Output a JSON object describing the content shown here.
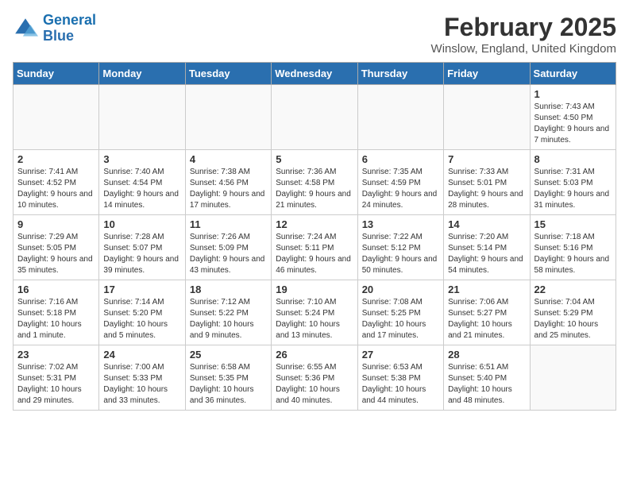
{
  "header": {
    "logo_line1": "General",
    "logo_line2": "Blue",
    "month_title": "February 2025",
    "location": "Winslow, England, United Kingdom"
  },
  "days_of_week": [
    "Sunday",
    "Monday",
    "Tuesday",
    "Wednesday",
    "Thursday",
    "Friday",
    "Saturday"
  ],
  "weeks": [
    [
      {
        "day": "",
        "text": ""
      },
      {
        "day": "",
        "text": ""
      },
      {
        "day": "",
        "text": ""
      },
      {
        "day": "",
        "text": ""
      },
      {
        "day": "",
        "text": ""
      },
      {
        "day": "",
        "text": ""
      },
      {
        "day": "1",
        "text": "Sunrise: 7:43 AM\nSunset: 4:50 PM\nDaylight: 9 hours and 7 minutes."
      }
    ],
    [
      {
        "day": "2",
        "text": "Sunrise: 7:41 AM\nSunset: 4:52 PM\nDaylight: 9 hours and 10 minutes."
      },
      {
        "day": "3",
        "text": "Sunrise: 7:40 AM\nSunset: 4:54 PM\nDaylight: 9 hours and 14 minutes."
      },
      {
        "day": "4",
        "text": "Sunrise: 7:38 AM\nSunset: 4:56 PM\nDaylight: 9 hours and 17 minutes."
      },
      {
        "day": "5",
        "text": "Sunrise: 7:36 AM\nSunset: 4:58 PM\nDaylight: 9 hours and 21 minutes."
      },
      {
        "day": "6",
        "text": "Sunrise: 7:35 AM\nSunset: 4:59 PM\nDaylight: 9 hours and 24 minutes."
      },
      {
        "day": "7",
        "text": "Sunrise: 7:33 AM\nSunset: 5:01 PM\nDaylight: 9 hours and 28 minutes."
      },
      {
        "day": "8",
        "text": "Sunrise: 7:31 AM\nSunset: 5:03 PM\nDaylight: 9 hours and 31 minutes."
      }
    ],
    [
      {
        "day": "9",
        "text": "Sunrise: 7:29 AM\nSunset: 5:05 PM\nDaylight: 9 hours and 35 minutes."
      },
      {
        "day": "10",
        "text": "Sunrise: 7:28 AM\nSunset: 5:07 PM\nDaylight: 9 hours and 39 minutes."
      },
      {
        "day": "11",
        "text": "Sunrise: 7:26 AM\nSunset: 5:09 PM\nDaylight: 9 hours and 43 minutes."
      },
      {
        "day": "12",
        "text": "Sunrise: 7:24 AM\nSunset: 5:11 PM\nDaylight: 9 hours and 46 minutes."
      },
      {
        "day": "13",
        "text": "Sunrise: 7:22 AM\nSunset: 5:12 PM\nDaylight: 9 hours and 50 minutes."
      },
      {
        "day": "14",
        "text": "Sunrise: 7:20 AM\nSunset: 5:14 PM\nDaylight: 9 hours and 54 minutes."
      },
      {
        "day": "15",
        "text": "Sunrise: 7:18 AM\nSunset: 5:16 PM\nDaylight: 9 hours and 58 minutes."
      }
    ],
    [
      {
        "day": "16",
        "text": "Sunrise: 7:16 AM\nSunset: 5:18 PM\nDaylight: 10 hours and 1 minute."
      },
      {
        "day": "17",
        "text": "Sunrise: 7:14 AM\nSunset: 5:20 PM\nDaylight: 10 hours and 5 minutes."
      },
      {
        "day": "18",
        "text": "Sunrise: 7:12 AM\nSunset: 5:22 PM\nDaylight: 10 hours and 9 minutes."
      },
      {
        "day": "19",
        "text": "Sunrise: 7:10 AM\nSunset: 5:24 PM\nDaylight: 10 hours and 13 minutes."
      },
      {
        "day": "20",
        "text": "Sunrise: 7:08 AM\nSunset: 5:25 PM\nDaylight: 10 hours and 17 minutes."
      },
      {
        "day": "21",
        "text": "Sunrise: 7:06 AM\nSunset: 5:27 PM\nDaylight: 10 hours and 21 minutes."
      },
      {
        "day": "22",
        "text": "Sunrise: 7:04 AM\nSunset: 5:29 PM\nDaylight: 10 hours and 25 minutes."
      }
    ],
    [
      {
        "day": "23",
        "text": "Sunrise: 7:02 AM\nSunset: 5:31 PM\nDaylight: 10 hours and 29 minutes."
      },
      {
        "day": "24",
        "text": "Sunrise: 7:00 AM\nSunset: 5:33 PM\nDaylight: 10 hours and 33 minutes."
      },
      {
        "day": "25",
        "text": "Sunrise: 6:58 AM\nSunset: 5:35 PM\nDaylight: 10 hours and 36 minutes."
      },
      {
        "day": "26",
        "text": "Sunrise: 6:55 AM\nSunset: 5:36 PM\nDaylight: 10 hours and 40 minutes."
      },
      {
        "day": "27",
        "text": "Sunrise: 6:53 AM\nSunset: 5:38 PM\nDaylight: 10 hours and 44 minutes."
      },
      {
        "day": "28",
        "text": "Sunrise: 6:51 AM\nSunset: 5:40 PM\nDaylight: 10 hours and 48 minutes."
      },
      {
        "day": "",
        "text": ""
      }
    ]
  ]
}
